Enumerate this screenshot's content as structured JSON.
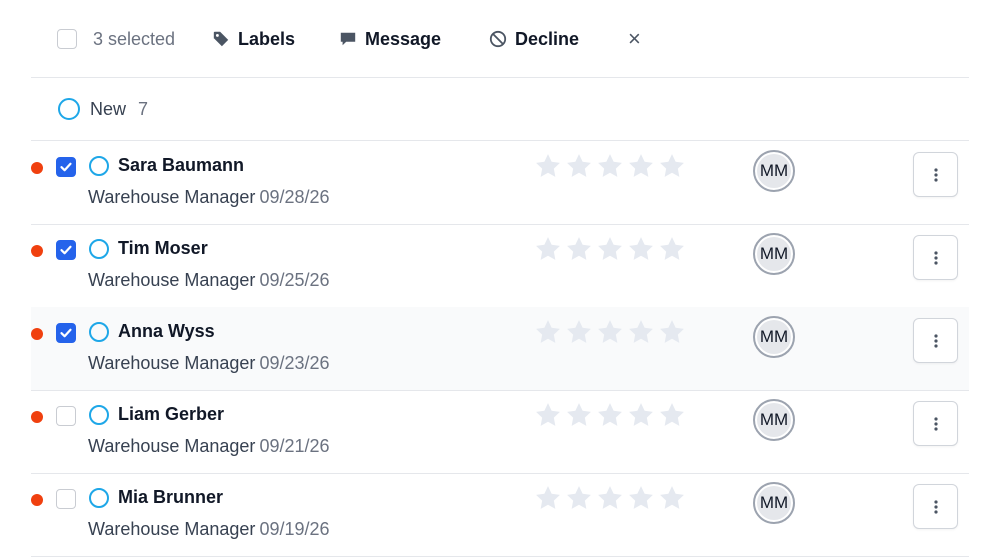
{
  "toolbar": {
    "selected_text": "3 selected",
    "labels_label": "Labels",
    "message_label": "Message",
    "decline_label": "Decline",
    "close_glyph": "×"
  },
  "group": {
    "label": "New",
    "count": "7"
  },
  "colors": {
    "accent": "#2563eb",
    "ring": "#1ea7e8",
    "dot": "#f0400f",
    "star": "#e5e9f0"
  },
  "candidates": [
    {
      "name": "Sara Baumann",
      "job": "Warehouse Manager",
      "date": "09/28/26",
      "checked": true,
      "rating": 0,
      "avatar": "MM"
    },
    {
      "name": "Tim Moser",
      "job": "Warehouse Manager",
      "date": "09/25/26",
      "checked": true,
      "rating": 0,
      "avatar": "MM"
    },
    {
      "name": "Anna Wyss",
      "job": "Warehouse Manager",
      "date": "09/23/26",
      "checked": true,
      "rating": 0,
      "avatar": "MM"
    },
    {
      "name": "Liam Gerber",
      "job": "Warehouse Manager",
      "date": "09/21/26",
      "checked": false,
      "rating": 0,
      "avatar": "MM"
    },
    {
      "name": "Mia Brunner",
      "job": "Warehouse Manager",
      "date": "09/19/26",
      "checked": false,
      "rating": 0,
      "avatar": "MM"
    }
  ],
  "icons": {
    "select_all": "checkbox",
    "labels": "tag-icon",
    "message": "chat-bubble-icon",
    "decline": "ban-icon",
    "close": "close-icon",
    "status": "ring-icon",
    "more": "more-vertical-icon",
    "star": "star-icon"
  }
}
